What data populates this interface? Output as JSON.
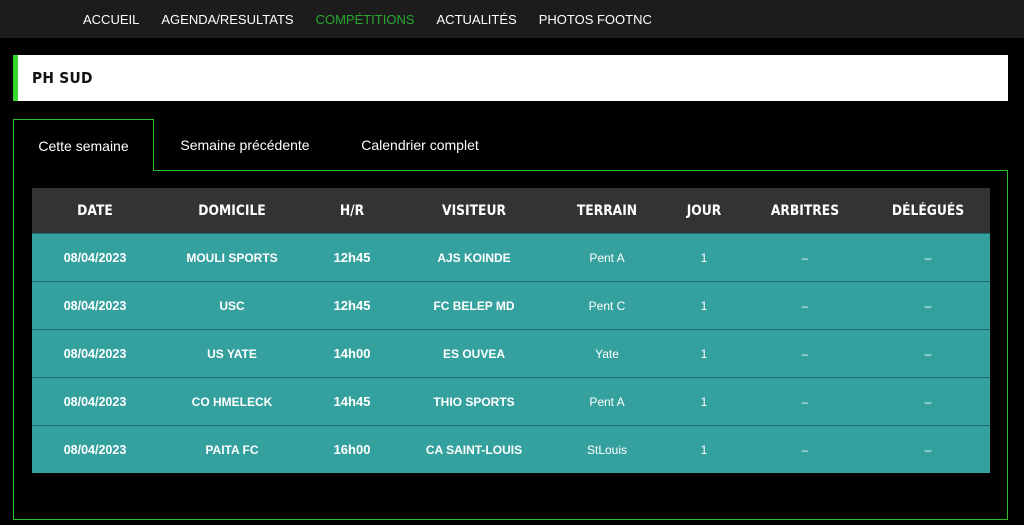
{
  "nav": {
    "items": [
      {
        "label": "ACCUEIL"
      },
      {
        "label": "AGENDA/RESULTATS"
      },
      {
        "label": "COMPÉTITIONS"
      },
      {
        "label": "ACTUALITÉS"
      },
      {
        "label": "PHOTOS FOOTNC"
      }
    ],
    "active_index": 2,
    "active_color": "#28a82e"
  },
  "page_title": "PH SUD",
  "accent_color": "#36d62c",
  "tabs": [
    {
      "label": "Cette semaine",
      "active": true
    },
    {
      "label": "Semaine précédente",
      "active": false
    },
    {
      "label": "Calendrier complet",
      "active": false
    }
  ],
  "table": {
    "headers": [
      "DATE",
      "DOMICILE",
      "H/R",
      "VISITEUR",
      "TERRAIN",
      "JOUR",
      "ARBITRES",
      "DÉLÉGUÉS"
    ],
    "row_color": "#35a19e",
    "rows": [
      {
        "date": "08/04/2023",
        "home": "MOULI SPORTS",
        "time": "12h45",
        "away": "AJS KOINDE",
        "field": "Pent A",
        "day": "1",
        "referees": "–",
        "delegates": "–"
      },
      {
        "date": "08/04/2023",
        "home": "USC",
        "time": "12h45",
        "away": "FC BELEP MD",
        "field": "Pent C",
        "day": "1",
        "referees": "–",
        "delegates": "–"
      },
      {
        "date": "08/04/2023",
        "home": "US YATE",
        "time": "14h00",
        "away": "ES OUVEA",
        "field": "Yate",
        "day": "1",
        "referees": "–",
        "delegates": "–"
      },
      {
        "date": "08/04/2023",
        "home": "CO HMELECK",
        "time": "14h45",
        "away": "THIO SPORTS",
        "field": "Pent A",
        "day": "1",
        "referees": "–",
        "delegates": "–"
      },
      {
        "date": "08/04/2023",
        "home": "PAITA FC",
        "time": "16h00",
        "away": "CA SAINT-LOUIS",
        "field": "StLouis",
        "day": "1",
        "referees": "–",
        "delegates": "–"
      }
    ]
  }
}
